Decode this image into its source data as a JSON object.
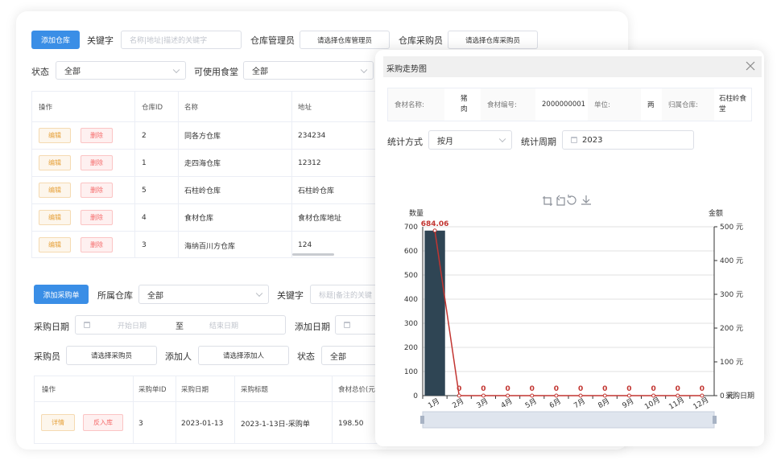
{
  "warehouse": {
    "add_label": "添加仓库",
    "keyword_label": "关键字",
    "keyword_placeholder": "名称|地址|描述的关键字",
    "manager_label": "仓库管理员",
    "manager_pick": "请选择仓库管理员",
    "buyer_label": "仓库采购员",
    "buyer_pick": "请选择仓库采购员",
    "status_label": "状态",
    "status_value": "全部",
    "canteen_label": "可使用食堂",
    "canteen_value": "全部",
    "columns": [
      "操作",
      "仓库ID",
      "名称",
      "地址"
    ],
    "edit_label": "编辑",
    "delete_label": "删除",
    "rows": [
      {
        "id": "2",
        "name": "同各方仓库",
        "address": "234234"
      },
      {
        "id": "1",
        "name": "走四海仓库",
        "address": "12312"
      },
      {
        "id": "5",
        "name": "石柱岭仓库",
        "address": "石柱岭仓库"
      },
      {
        "id": "4",
        "name": "食材仓库",
        "address": "食材仓库地址"
      },
      {
        "id": "3",
        "name": "海纳百川方仓库",
        "address": "124"
      }
    ]
  },
  "purchase": {
    "add_label": "添加采购单",
    "warehouse_label": "所属仓库",
    "warehouse_value": "全部",
    "keyword_label": "关键字",
    "keyword_placeholder": "标题|备注的关键",
    "date_label": "采购日期",
    "start_placeholder": "开始日期",
    "to_label": "至",
    "end_placeholder": "结束日期",
    "add_date_label": "添加日期",
    "buyer_label": "采购员",
    "buyer_pick": "请选择采购员",
    "adder_label": "添加人",
    "adder_pick": "请选择添加人",
    "status_label": "状态",
    "status_value": "全部",
    "columns": [
      "操作",
      "采购单ID",
      "采购日期",
      "采购标题",
      "食材总价(元"
    ],
    "detail_label": "详情",
    "reverse_label": "反入库",
    "row": {
      "id": "3",
      "date": "2023-01-13",
      "title": "2023-1-13日-采购单",
      "total": "198.50"
    }
  },
  "modal": {
    "title": "采购走势图",
    "info": {
      "name_key": "食材名称:",
      "name_value_1": "猪",
      "name_value_2": "肉",
      "code_key": "食材编号:",
      "code_value": "2000000001",
      "unit_key": "单位:",
      "unit_value": "两",
      "warehouse_key": "归属仓库:",
      "warehouse_value_1": "石柱岭食",
      "warehouse_value_2": "堂"
    },
    "stat_label": "统计方式",
    "stat_value": "按月",
    "period_label": "统计周期",
    "period_value": "2023"
  },
  "colors": {
    "primary": "#3a8ee6",
    "bar": "#2f4554",
    "line": "#c23531"
  },
  "icons": [
    "close-icon",
    "zoom-icon",
    "zoom-back-icon",
    "restore-icon",
    "download-icon",
    "calendar-icon",
    "chevron-down-icon"
  ],
  "chart_data": {
    "type": "bar",
    "categories": [
      "1月",
      "2月",
      "3月",
      "4月",
      "5月",
      "6月",
      "7月",
      "8月",
      "9月",
      "10月",
      "11月",
      "12月"
    ],
    "series": [
      {
        "type": "bar",
        "values": [
          684.06,
          0,
          0,
          0,
          0,
          0,
          0,
          0,
          0,
          0,
          0,
          0
        ]
      },
      {
        "type": "line",
        "values": [
          684.06,
          0,
          0,
          0,
          0,
          0,
          0,
          0,
          0,
          0,
          0,
          0
        ]
      }
    ],
    "data_labels": [
      "684.06",
      "0",
      "0",
      "0",
      "0",
      "0",
      "0",
      "0",
      "0",
      "0",
      "0",
      "0"
    ],
    "ylabel": "数量",
    "ylim": [
      0,
      700
    ],
    "yticks": [
      "0",
      "100",
      "200",
      "300",
      "400",
      "500",
      "600",
      "700"
    ],
    "y2label": "金额",
    "y2lim": [
      0,
      500
    ],
    "y2ticks": [
      "0 元",
      "100 元",
      "200 元",
      "300 元",
      "400 元",
      "500 元"
    ],
    "xlabel": "采购日期",
    "grid": true
  }
}
